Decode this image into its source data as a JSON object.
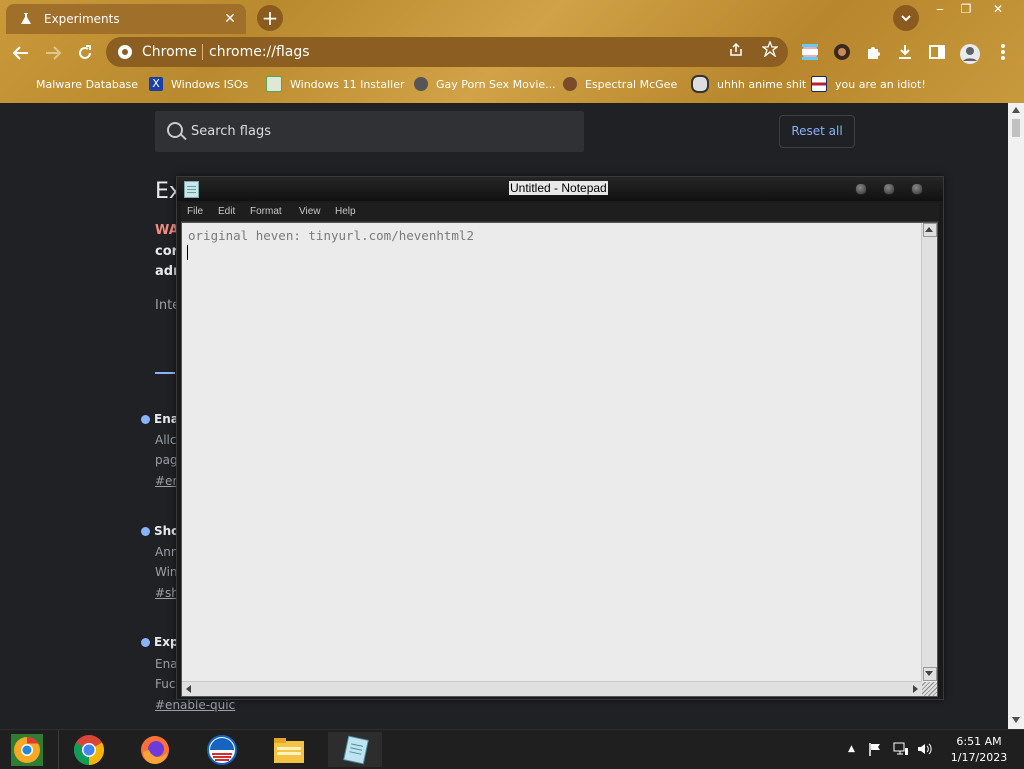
{
  "browser": {
    "tab_title": "Experiments",
    "tab_close": "✕",
    "new_tab": "+",
    "omnibox_site": "Chrome",
    "omnibox_url": "chrome://flags",
    "window_controls": [
      "‒",
      "❐",
      "✕"
    ],
    "bookmarks": [
      {
        "label": "Malware Database",
        "icon_color": "#c0392b"
      },
      {
        "label": "Windows ISOs",
        "icon_color": "#1a3fa8"
      },
      {
        "label": "Windows 11 Installer",
        "icon_color": "#5aa35a"
      },
      {
        "label": "Gay Porn Sex Movie...",
        "icon_color": "#555555"
      },
      {
        "label": "Espectral McGee",
        "icon_color": "#7a4a2a"
      },
      {
        "label": "uhhh anime shit",
        "icon_color": "#333333"
      },
      {
        "label": "you are an idiot!",
        "icon_color": "#b22234"
      }
    ]
  },
  "flags_page": {
    "search_placeholder": "Search flags",
    "reset_all": "Reset all",
    "heading_partial": "Ex",
    "warning_partial": "WA",
    "line2_partial": "cor",
    "line3_partial": "adr",
    "line4_partial": "Inte",
    "flags": [
      {
        "title": "Ena",
        "line1": "Allc",
        "line2": "pag",
        "link": "#en"
      },
      {
        "title": "Sho",
        "line1": "Ann",
        "line2": "Win",
        "link": "#sh"
      },
      {
        "title": "Exp",
        "line1": "Ena",
        "line2": "Fuc",
        "link": "#enable-quic"
      }
    ]
  },
  "notepad": {
    "title": "Untitled - Notepad",
    "menu": [
      "File",
      "Edit",
      "Format",
      "View",
      "Help"
    ],
    "content": "original heven: tinyurl.com/hevenhtml2"
  },
  "taskbar": {
    "apps": [
      "chrome-canary",
      "chrome",
      "firefox",
      "obama",
      "file-explorer",
      "notepad"
    ],
    "time": "6:51 AM",
    "date": "1/17/2023",
    "tray_arrow": "▲"
  }
}
